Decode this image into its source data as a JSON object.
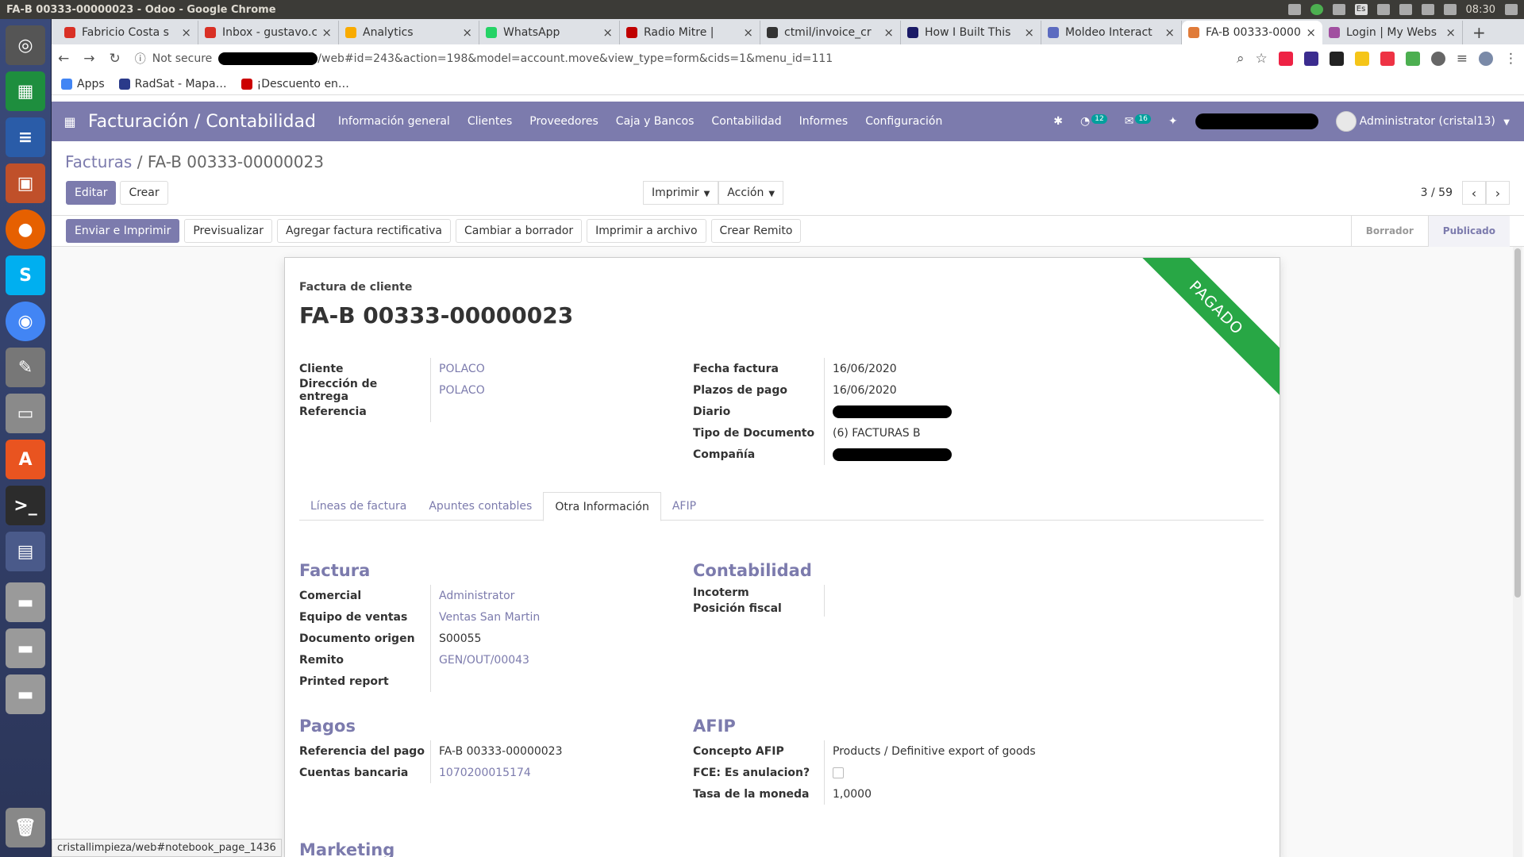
{
  "os": {
    "window_title": "FA-B 00333-00000023 - Odoo - Google Chrome",
    "time": "08:30",
    "lang": "Es"
  },
  "browser": {
    "tabs": [
      {
        "label": "Fabricio Costa s",
        "color": "#d93025"
      },
      {
        "label": "Inbox - gustavo.c",
        "color": "#d93025"
      },
      {
        "label": "Analytics",
        "color": "#f9ab00"
      },
      {
        "label": "WhatsApp",
        "color": "#25d366"
      },
      {
        "label": "Radio Mitre |",
        "color": "#c00000"
      },
      {
        "label": "ctmil/invoice_cr",
        "color": "#333333"
      },
      {
        "label": "How I Built This",
        "color": "#1a1a66"
      },
      {
        "label": "Moldeo Interact",
        "color": "#5c6bc0"
      },
      {
        "label": "FA-B 00333-0000",
        "color": "#e07b39"
      },
      {
        "label": "Login | My Webs",
        "color": "#a14fa0"
      }
    ],
    "active_tab": 8,
    "security": "Not secure",
    "url_rest": "/web#id=243&action=198&model=account.move&view_type=form&cids=1&menu_id=111",
    "bookmarks": [
      "Apps",
      "RadSat - Mapa…",
      "¡Descuento en…"
    ],
    "status_url": "cristallimpieza/web#notebook_page_1436"
  },
  "odoo": {
    "app_title": "Facturación / Contabilidad",
    "menu": [
      "Información general",
      "Clientes",
      "Proveedores",
      "Caja y Bancos",
      "Contabilidad",
      "Informes",
      "Configuración"
    ],
    "activity_count": "12",
    "message_count": "16",
    "user": "Administrator (cristal13)",
    "breadcrumb_parent": "Facturas",
    "breadcrumb_current": "FA-B 00333-00000023",
    "edit": "Editar",
    "create": "Crear",
    "print": "Imprimir",
    "action": "Acción",
    "pager": "3 / 59",
    "header_buttons": [
      "Enviar e Imprimir",
      "Previsualizar",
      "Agregar factura rectificativa",
      "Cambiar a borrador",
      "Imprimir a archivo",
      "Crear Remito"
    ],
    "stages": [
      "Borrador",
      "Publicado"
    ],
    "active_stage": 1
  },
  "form": {
    "ribbon": "PAGADO",
    "doc_type": "Factura de cliente",
    "doc_name": "FA-B 00333-00000023",
    "left_fields": [
      {
        "label": "Cliente",
        "value": "POLACO",
        "link": true
      },
      {
        "label": "Dirección de entrega",
        "value": "POLACO",
        "link": true
      },
      {
        "label": "Referencia",
        "value": "",
        "link": false
      }
    ],
    "right_fields": [
      {
        "label": "Fecha factura",
        "value": "16/06/2020"
      },
      {
        "label": "Plazos de pago",
        "value": "16/06/2020"
      },
      {
        "label": "Diario",
        "value": ""
      },
      {
        "label": "Tipo de Documento",
        "value": "(6) FACTURAS B"
      },
      {
        "label": "Compañía",
        "value": ""
      }
    ],
    "tabs": [
      "Líneas de factura",
      "Apuntes contables",
      "Otra Información",
      "AFIP"
    ],
    "active_tab": 2,
    "sections": {
      "factura": {
        "title": "Factura",
        "fields": [
          {
            "label": "Comercial",
            "value": "Administrator",
            "link": true
          },
          {
            "label": "Equipo de ventas",
            "value": "Ventas San Martin",
            "link": true
          },
          {
            "label": "Documento origen",
            "value": "S00055",
            "link": false
          },
          {
            "label": "Remito",
            "value": "GEN/OUT/00043",
            "link": true
          },
          {
            "label": "Printed report",
            "value": "",
            "link": false
          }
        ]
      },
      "contabilidad": {
        "title": "Contabilidad",
        "fields": [
          {
            "label": "Incoterm",
            "value": ""
          },
          {
            "label": "Posición fiscal",
            "value": ""
          }
        ]
      },
      "pagos": {
        "title": "Pagos",
        "fields": [
          {
            "label": "Referencia del pago",
            "value": "FA-B 00333-00000023",
            "link": false
          },
          {
            "label": "Cuentas bancaria",
            "value": "1070200015174",
            "link": true
          }
        ]
      },
      "afip": {
        "title": "AFIP",
        "concepto_label": "Concepto AFIP",
        "concepto_value": "Products / Definitive export of goods",
        "fce_label": "FCE: Es anulacion?",
        "tasa_label": "Tasa de la moneda",
        "tasa_value": "1,0000"
      },
      "marketing": {
        "title": "Marketing"
      }
    }
  }
}
